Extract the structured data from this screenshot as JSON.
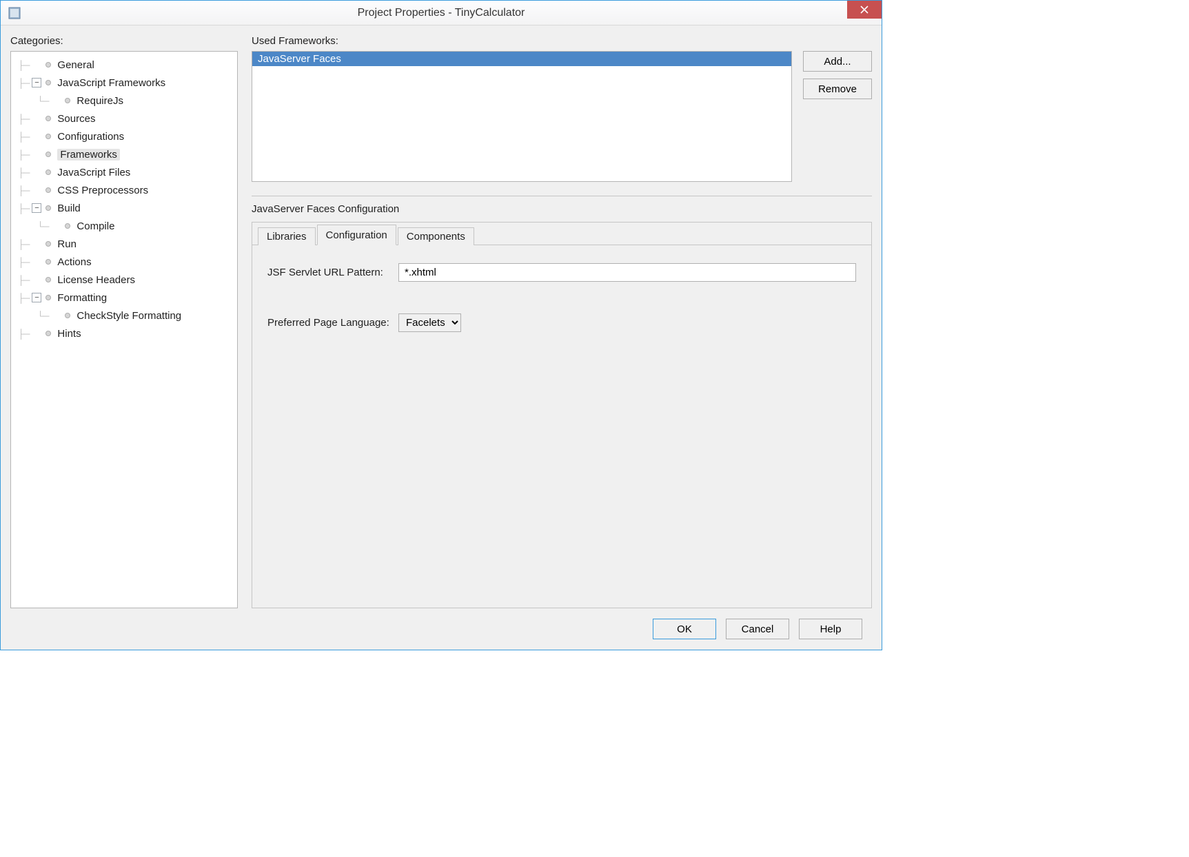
{
  "window": {
    "title": "Project Properties - TinyCalculator"
  },
  "categories_label": "Categories:",
  "tree": [
    {
      "label": "General",
      "depth": 0,
      "expander": "",
      "selected": false
    },
    {
      "label": "JavaScript Frameworks",
      "depth": 0,
      "expander": "−",
      "selected": false
    },
    {
      "label": "RequireJs",
      "depth": 1,
      "expander": "",
      "selected": false
    },
    {
      "label": "Sources",
      "depth": 0,
      "expander": "",
      "selected": false
    },
    {
      "label": "Configurations",
      "depth": 0,
      "expander": "",
      "selected": false
    },
    {
      "label": "Frameworks",
      "depth": 0,
      "expander": "",
      "selected": true
    },
    {
      "label": "JavaScript Files",
      "depth": 0,
      "expander": "",
      "selected": false
    },
    {
      "label": "CSS Preprocessors",
      "depth": 0,
      "expander": "",
      "selected": false
    },
    {
      "label": "Build",
      "depth": 0,
      "expander": "−",
      "selected": false
    },
    {
      "label": "Compile",
      "depth": 1,
      "expander": "",
      "selected": false
    },
    {
      "label": "Run",
      "depth": 0,
      "expander": "",
      "selected": false
    },
    {
      "label": "Actions",
      "depth": 0,
      "expander": "",
      "selected": false
    },
    {
      "label": "License Headers",
      "depth": 0,
      "expander": "",
      "selected": false
    },
    {
      "label": "Formatting",
      "depth": 0,
      "expander": "−",
      "selected": false
    },
    {
      "label": "CheckStyle Formatting",
      "depth": 1,
      "expander": "",
      "selected": false
    },
    {
      "label": "Hints",
      "depth": 0,
      "expander": "",
      "selected": false
    }
  ],
  "used_frameworks_label": "Used Frameworks:",
  "used_frameworks": [
    "JavaServer Faces"
  ],
  "buttons": {
    "add": "Add...",
    "remove": "Remove",
    "ok": "OK",
    "cancel": "Cancel",
    "help": "Help"
  },
  "config_section_title": "JavaServer Faces Configuration",
  "tabs": [
    {
      "label": "Libraries",
      "active": false
    },
    {
      "label": "Configuration",
      "active": true
    },
    {
      "label": "Components",
      "active": false
    }
  ],
  "config_form": {
    "url_pattern_label": "JSF Servlet URL Pattern:",
    "url_pattern_value": "*.xhtml",
    "page_lang_label": "Preferred Page Language:",
    "page_lang_value": "Facelets"
  }
}
